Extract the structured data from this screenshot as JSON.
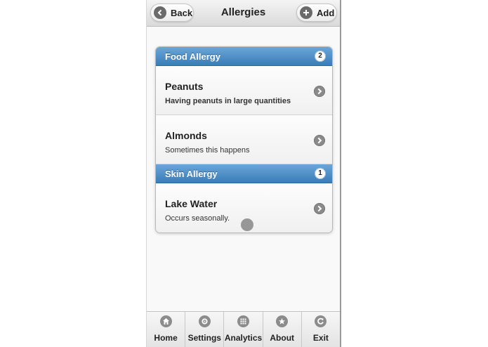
{
  "header": {
    "title": "Allergies",
    "back_label": "Back",
    "add_label": "Add",
    "back_icon": "arrow-left-icon",
    "add_icon": "plus-icon"
  },
  "groups": [
    {
      "title": "Food Allergy",
      "count": "2",
      "items": [
        {
          "title": "Peanuts",
          "description": "Having peanuts in large quantities"
        },
        {
          "title": "Almonds",
          "description": "Sometimes this happens"
        }
      ]
    },
    {
      "title": "Skin Allergy",
      "count": "1",
      "items": [
        {
          "title": "Lake Water",
          "description": "Occurs seasonally."
        }
      ]
    }
  ],
  "navbar": [
    {
      "label": "Home",
      "icon": "home-icon"
    },
    {
      "label": "Settings",
      "icon": "gear-icon"
    },
    {
      "label": "Analytics",
      "icon": "grid-icon"
    },
    {
      "label": "About",
      "icon": "star-icon"
    },
    {
      "label": "Exit",
      "icon": "refresh-icon"
    }
  ],
  "colors": {
    "divider_top": "#6aa6d8",
    "divider_bottom": "#3b7cb8",
    "icon_gray": "#8c8c8c"
  }
}
